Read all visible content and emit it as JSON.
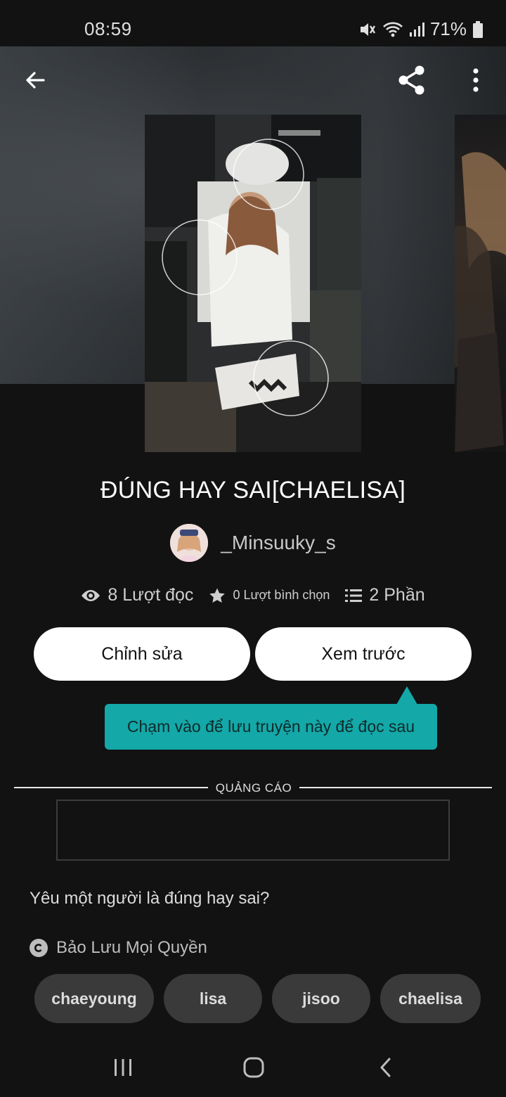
{
  "status_bar": {
    "time": "08:59",
    "battery": "71%"
  },
  "header": {
    "back_icon": "arrow-left-icon",
    "share_icon": "share-icon",
    "more_icon": "more-vertical-icon"
  },
  "story": {
    "title": "ĐÚNG HAY SAI[CHAELISA]",
    "author": "_Minsuuky_s",
    "stats": {
      "reads": "8 Lượt đọc",
      "votes": "0 Lượt bình chọn",
      "parts": "2 Phần"
    },
    "description": "Yêu một người là đúng hay sai?",
    "copyright": "Bảo Lưu Mọi Quyền"
  },
  "actions": {
    "edit_label": "Chỉnh sửa",
    "preview_label": "Xem trước"
  },
  "tooltip": {
    "text": "Chạm vào để lưu truyện này để đọc sau"
  },
  "ad": {
    "label": "QUẢNG CÁO"
  },
  "tags": [
    "chaeyoung",
    "lisa",
    "jisoo",
    "chaelisa"
  ],
  "colors": {
    "background": "#121212",
    "tooltip": "#14a8a8",
    "button": "#ffffff",
    "tag": "#3a3a3a"
  }
}
